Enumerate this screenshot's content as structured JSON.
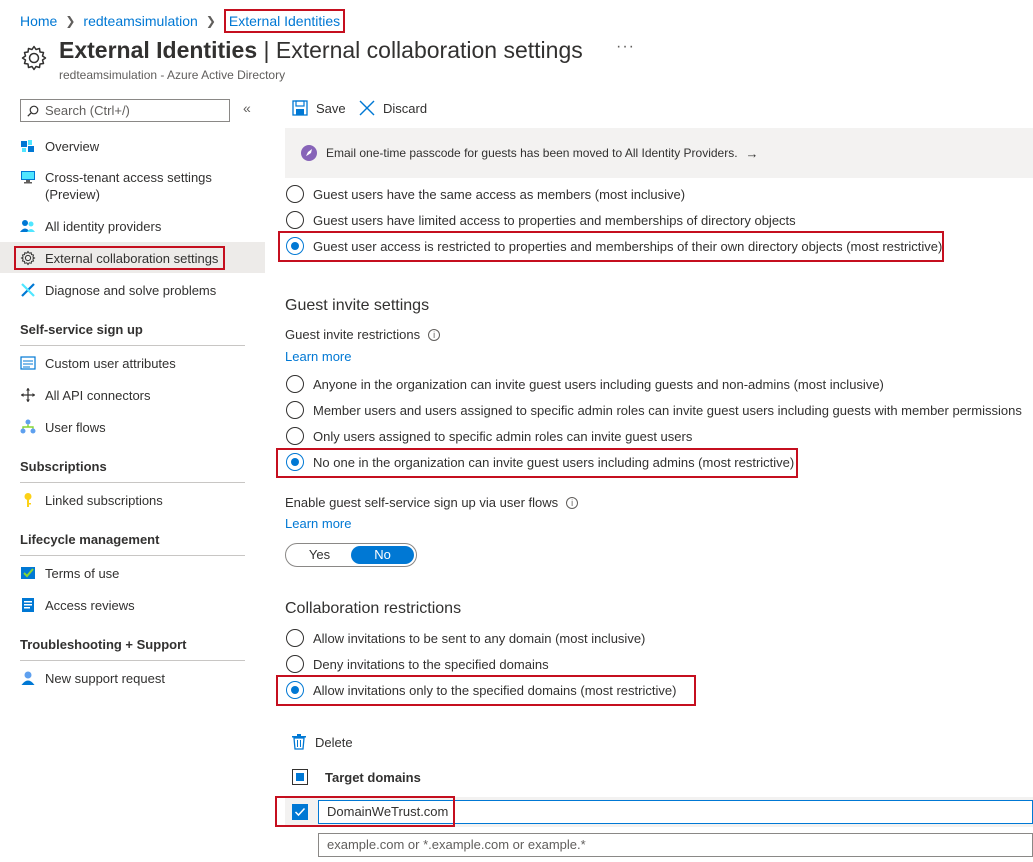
{
  "breadcrumb": {
    "items": [
      "Home",
      "redteamsimulation"
    ],
    "current": "External Identities"
  },
  "header": {
    "title_bold": "External Identities",
    "title_separator": " | ",
    "title_light": "External collaboration settings",
    "more": "···",
    "subtitle": "redteamsimulation - Azure Active Directory"
  },
  "sidebar": {
    "search_placeholder": "Search (Ctrl+/)",
    "collapse": "«",
    "items": [
      {
        "label": "Overview",
        "icon": "overview-icon"
      },
      {
        "label": "Cross-tenant access settings",
        "label2": "(Preview)",
        "icon": "cross-tenant-icon"
      },
      {
        "label": "All identity providers",
        "icon": "identity-providers-icon"
      },
      {
        "label": "External collaboration settings",
        "icon": "gear-icon",
        "selected": true
      },
      {
        "label": "Diagnose and solve problems",
        "icon": "wrench-icon"
      }
    ],
    "sections": [
      {
        "title": "Self-service sign up",
        "items": [
          {
            "label": "Custom user attributes",
            "icon": "attributes-icon"
          },
          {
            "label": "All API connectors",
            "icon": "api-connectors-icon"
          },
          {
            "label": "User flows",
            "icon": "user-flows-icon"
          }
        ]
      },
      {
        "title": "Subscriptions",
        "items": [
          {
            "label": "Linked subscriptions",
            "icon": "key-icon"
          }
        ]
      },
      {
        "title": "Lifecycle management",
        "items": [
          {
            "label": "Terms of use",
            "icon": "terms-icon"
          },
          {
            "label": "Access reviews",
            "icon": "access-reviews-icon"
          }
        ]
      },
      {
        "title": "Troubleshooting + Support",
        "items": [
          {
            "label": "New support request",
            "icon": "support-icon"
          }
        ]
      }
    ]
  },
  "toolbar": {
    "save_label": "Save",
    "discard_label": "Discard"
  },
  "banner": {
    "text": "Email one-time passcode for guests has been moved to All Identity Providers.",
    "arrow": "→"
  },
  "guest_access": {
    "options": [
      "Guest users have the same access as members (most inclusive)",
      "Guest users have limited access to properties and memberships of directory objects",
      "Guest user access is restricted to properties and memberships of their own directory objects (most restrictive)"
    ],
    "selected": 2
  },
  "guest_invite": {
    "title": "Guest invite settings",
    "restrictions_label": "Guest invite restrictions",
    "learn_more": "Learn more",
    "options": [
      "Anyone in the organization can invite guest users including guests and non-admins (most inclusive)",
      "Member users and users assigned to specific admin roles can invite guest users including guests with member permissions",
      "Only users assigned to specific admin roles can invite guest users",
      "No one in the organization can invite guest users including admins (most restrictive)"
    ],
    "selected": 3,
    "self_service_label": "Enable guest self-service sign up via user flows",
    "self_service_learn_more": "Learn more",
    "toggle_yes": "Yes",
    "toggle_no": "No",
    "toggle_value": "No"
  },
  "collaboration": {
    "title": "Collaboration restrictions",
    "options": [
      "Allow invitations to be sent to any domain (most inclusive)",
      "Deny invitations to the specified domains",
      "Allow invitations only to the specified domains (most restrictive)"
    ],
    "selected": 2,
    "delete_label": "Delete",
    "table_header": "Target domains",
    "domains": [
      "DomainWeTrust.com"
    ],
    "new_domain_placeholder": "example.com or *.example.com or example.*"
  },
  "colors": {
    "accent": "#0078d4",
    "highlight": "#c50f1f",
    "banner_icon": "#8764b8"
  }
}
